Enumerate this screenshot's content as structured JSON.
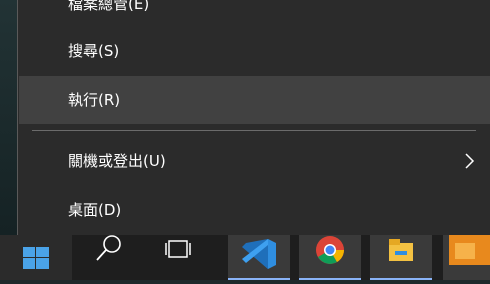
{
  "menu": {
    "items": [
      {
        "label": "檔案總管(E)"
      },
      {
        "label": "搜尋(S)"
      },
      {
        "label": "執行(R)"
      },
      {
        "label": "關機或登出(U)"
      },
      {
        "label": "桌面(D)"
      }
    ]
  },
  "taskbar": {
    "icons": [
      "windows-start-icon",
      "search-icon",
      "task-view-icon",
      "vscode-icon",
      "chrome-icon",
      "file-explorer-icon",
      "app-icon"
    ]
  },
  "colors": {
    "menu_bg": "#2b2b2b",
    "hover_bg": "#414141",
    "text": "#ffffff",
    "taskbar_bg": "#1e1e1e",
    "vscode_blue": "#2f8ee0",
    "orange_app": "#e8891d"
  }
}
